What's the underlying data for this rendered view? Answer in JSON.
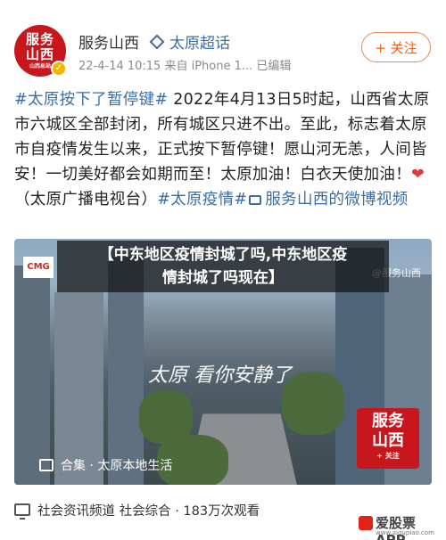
{
  "header": {
    "avatar_lines": [
      "服务",
      "山西",
      "山西总站"
    ],
    "author": "服务山西",
    "super_topic": "太原超话",
    "meta": "22-4-14 10:15  来自 iPhone 1...  已编辑",
    "follow_label": "+ 关注"
  },
  "post": {
    "tag1": "#太原按下了暂停键#",
    "text1": " 2022年4月13日5时起，山西省太原市六城区全部封闭，所有城区只进不出。至此，标志着太原市自疫情发生以来，正式按下暂停键！愿山河无恙，人间皆安！一切美好都会如期而至！太原加油！白衣天使加油！",
    "heart": "❤",
    "text2": "（太原广播电视台）",
    "tag2": "#太原疫情#",
    "link": "服务山西的微博视频"
  },
  "video": {
    "cmg": "CMG",
    "watermark": "@服务山西",
    "script_text": "太原 看你安静了",
    "logo_lines": [
      "服务",
      "山西",
      "+ 关注"
    ],
    "collection_label": "合集 · 太原本地生活"
  },
  "banner": {
    "line1": "【中东地区疫情封城了吗,中东地区疫",
    "line2": "情封城了吗现在】"
  },
  "footer": {
    "text": "社会资讯频道 社会综合 · 183万次观看"
  },
  "brand": {
    "name": "爱股票APP",
    "url": "www.aigupiao.com"
  },
  "colors": {
    "accent_blue": "#3a6ea5",
    "follow_orange": "#e4621f",
    "brand_red": "#c8161d"
  }
}
